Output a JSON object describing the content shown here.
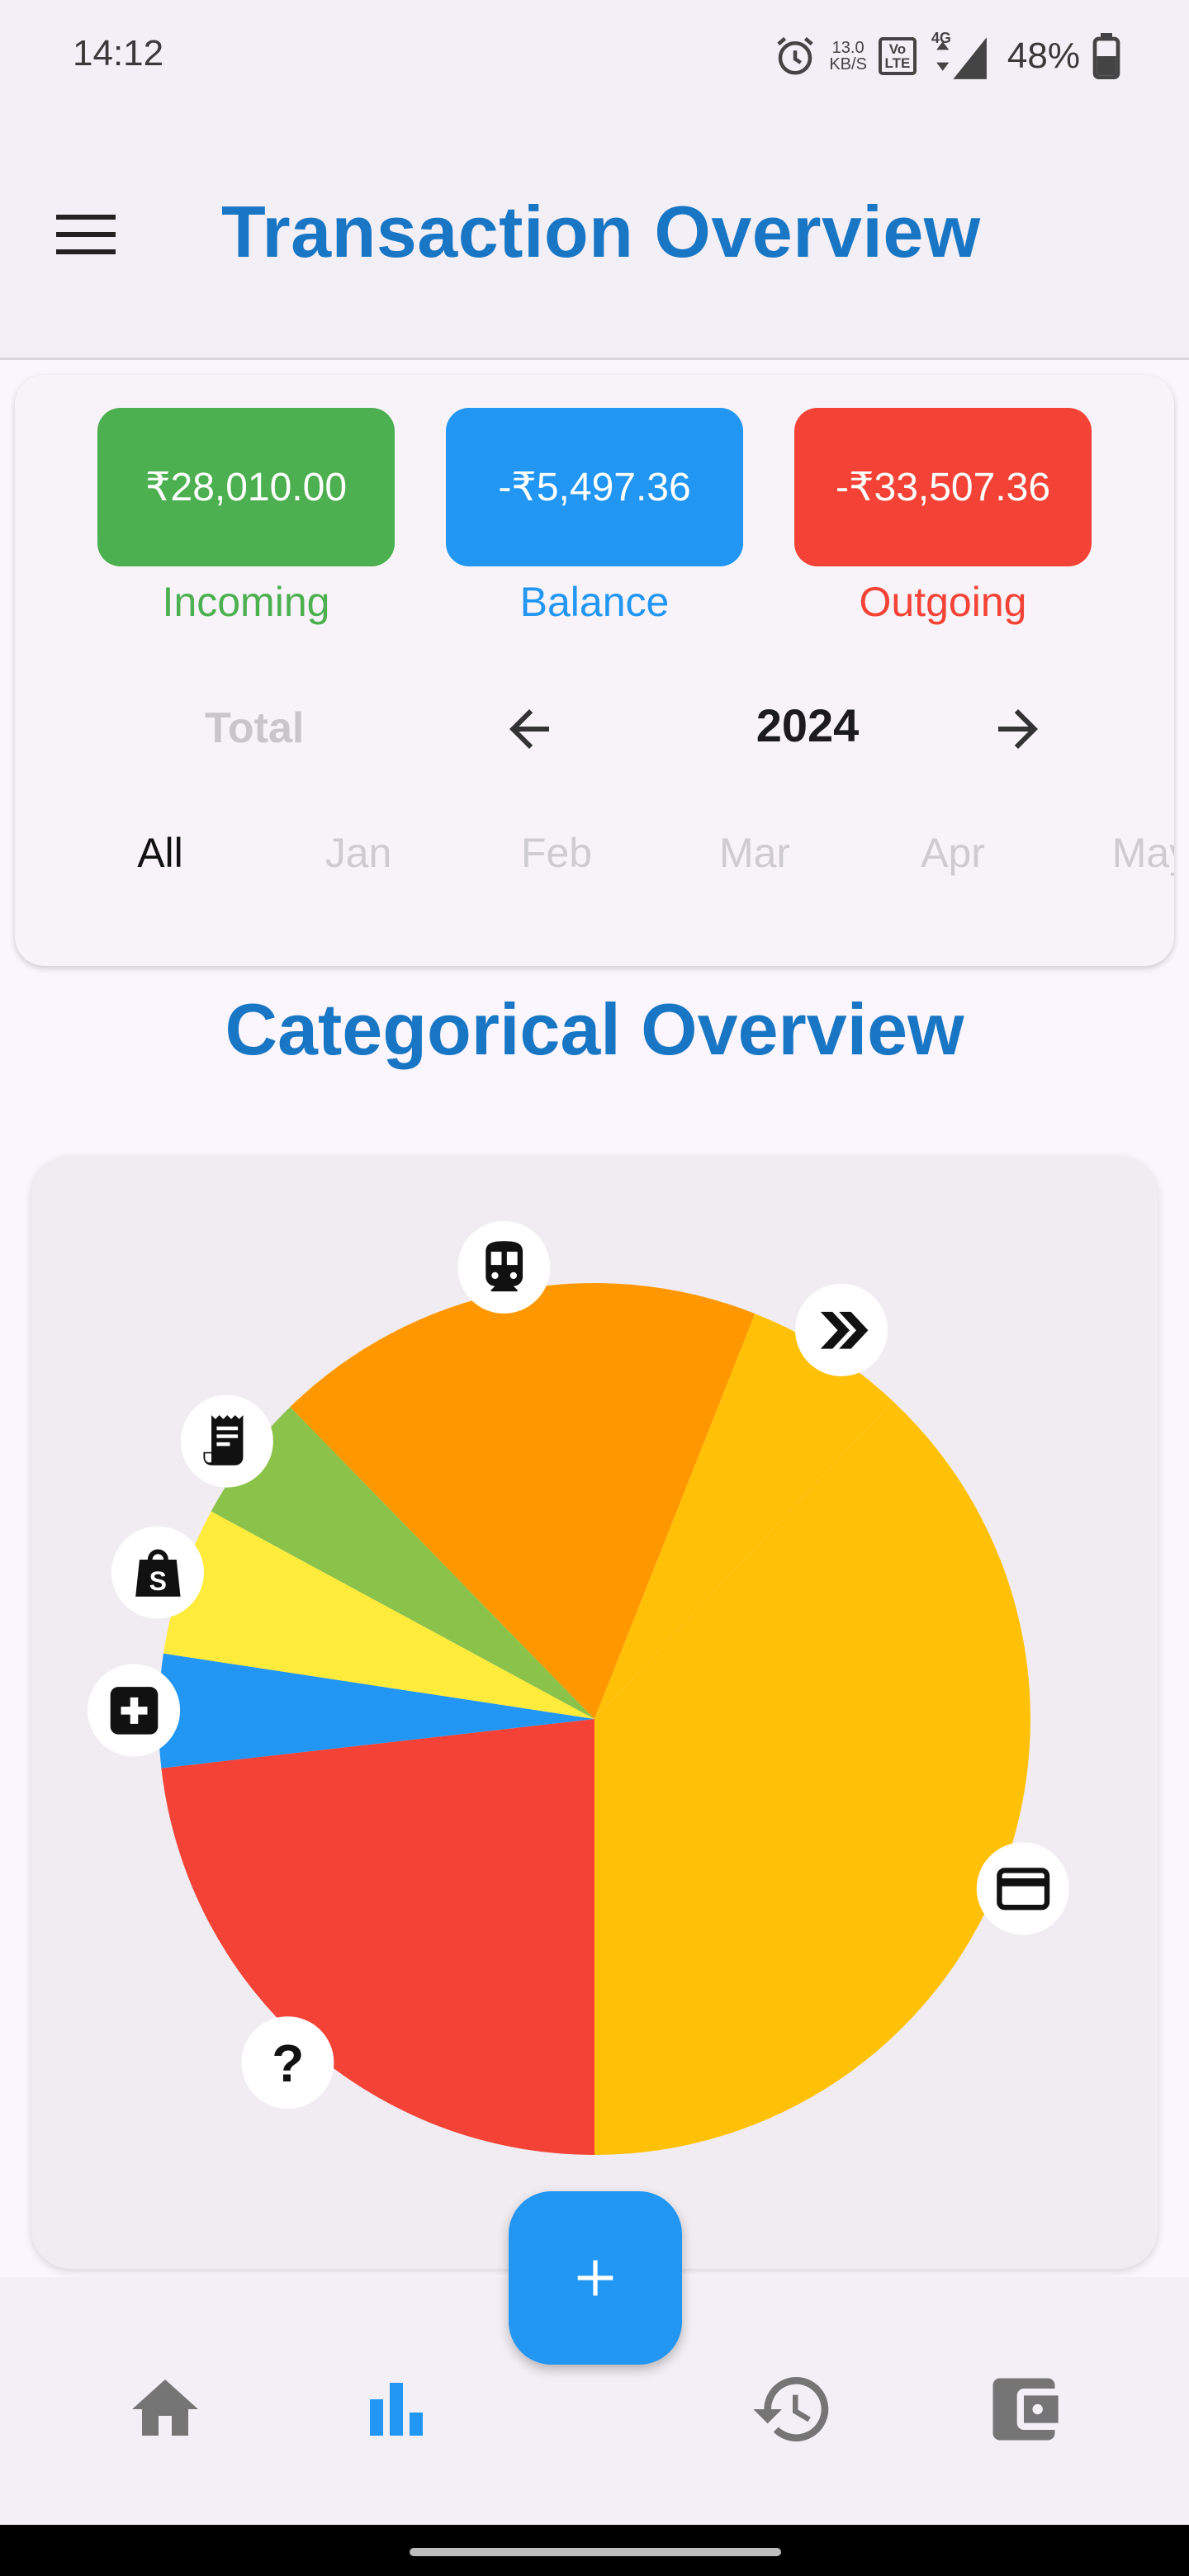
{
  "status_bar": {
    "time": "14:12",
    "net_speed_value": "13.0",
    "net_speed_unit": "KB/S",
    "volte_line1": "Vo",
    "volte_line2": "LTE",
    "network": "4G",
    "battery_percent": "48%",
    "icons": [
      "alarm-icon",
      "signal-icon",
      "battery-icon"
    ]
  },
  "app_bar": {
    "title": "Transaction Overview",
    "menu_icon": "hamburger-menu-icon"
  },
  "summary": {
    "incoming": {
      "amount": "₹28,010.00",
      "label": "Incoming",
      "color": "#4caf50"
    },
    "balance": {
      "amount": "-₹5,497.36",
      "label": "Balance",
      "color": "#2196f3"
    },
    "outgoing": {
      "amount": "-₹33,507.36",
      "label": "Outgoing",
      "color": "#f44336"
    },
    "total_label": "Total",
    "year": "2024",
    "months": [
      "All",
      "Jan",
      "Feb",
      "Mar",
      "Apr",
      "May"
    ],
    "selected_month": "All"
  },
  "categorical": {
    "title": "Categorical Overview"
  },
  "chart_data": {
    "type": "pie",
    "slices": [
      {
        "icon": "credit-card-icon",
        "value": 38.0,
        "color": "#ffc107"
      },
      {
        "icon": "question-mark-icon",
        "value": 23.2,
        "color": "#f44336"
      },
      {
        "icon": "medical-icon",
        "value": 4.2,
        "color": "#2196f3"
      },
      {
        "icon": "shopping-bag-icon",
        "value": 5.5,
        "color": "#ffeb3b"
      },
      {
        "icon": "receipt-icon",
        "value": 4.8,
        "color": "#8bc34a"
      },
      {
        "icon": "train-icon",
        "value": 18.3,
        "color": "#ff9800"
      },
      {
        "icon": "double-chevron-icon",
        "value": 6.0,
        "color": "#ffc107"
      }
    ]
  },
  "bottom_nav": {
    "items": [
      "home-icon",
      "bar-chart-icon",
      "history-icon",
      "wallet-icon"
    ],
    "active": "bar-chart-icon",
    "fab_icon": "plus-icon",
    "active_color": "#2196f3",
    "inactive_color": "#757575"
  }
}
